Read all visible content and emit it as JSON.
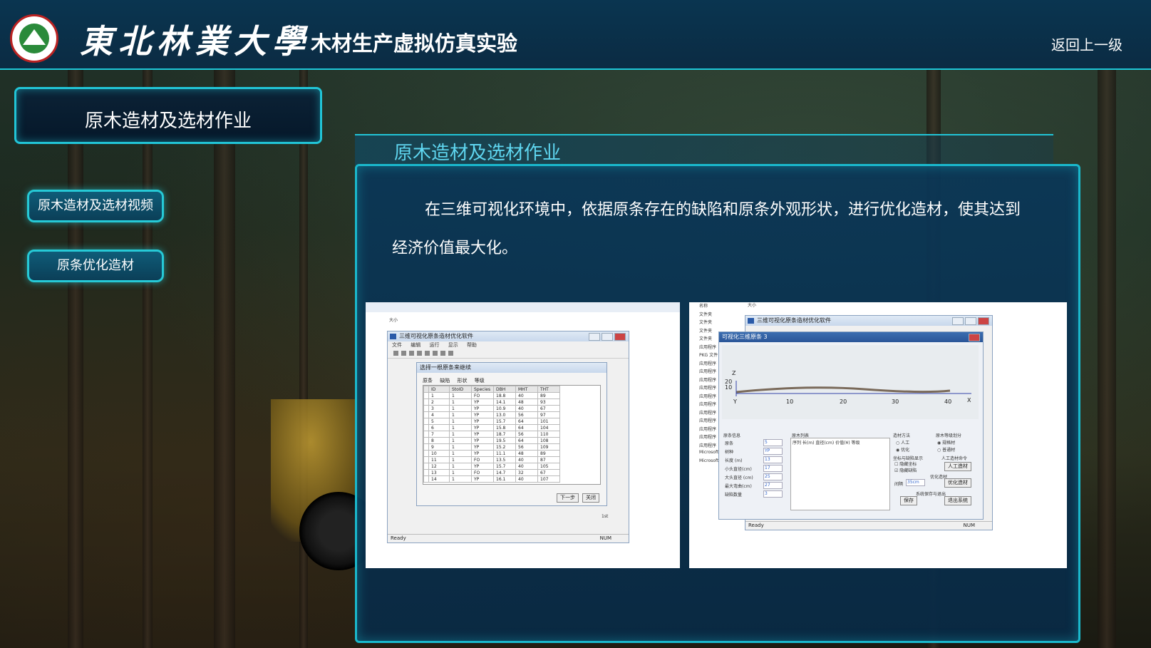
{
  "header": {
    "university": "東北林業大學",
    "app_title": "木材生产虚拟仿真实验",
    "back_label": "返回上一级"
  },
  "sidebar": {
    "title": "原木造材及选材作业",
    "items": [
      {
        "label": "原木造材及选材视频"
      },
      {
        "label": "原条优化造材"
      }
    ]
  },
  "main": {
    "heading": "原木造材及选材作业",
    "description": "在三维可视化环境中，依据原条存在的缺陷和原条外观形状，进行优化造材，使其达到经济价值最大化。"
  },
  "screenshot1": {
    "window_title": "三维可视化原条造材优化软件",
    "menu": [
      "文件",
      "编辑",
      "运行",
      "显示",
      "帮助"
    ],
    "dialog_title": "选择一根原条来继续",
    "tabs": [
      "原条",
      "缺陷",
      "形状",
      "等级"
    ],
    "columns": [
      "ID",
      "StoID",
      "Species",
      "DBH",
      "MHT",
      "THT"
    ],
    "rows": [
      [
        "1",
        "1",
        "FO",
        "18.8",
        "40",
        "89"
      ],
      [
        "2",
        "1",
        "YP",
        "14.1",
        "48",
        "93"
      ],
      [
        "3",
        "1",
        "YP",
        "10.9",
        "40",
        "67"
      ],
      [
        "4",
        "1",
        "YP",
        "13.0",
        "56",
        "97"
      ],
      [
        "5",
        "1",
        "YP",
        "15.7",
        "64",
        "101"
      ],
      [
        "6",
        "1",
        "YP",
        "15.8",
        "64",
        "104"
      ],
      [
        "7",
        "1",
        "YP",
        "18.7",
        "56",
        "110"
      ],
      [
        "8",
        "1",
        "YP",
        "19.5",
        "64",
        "108"
      ],
      [
        "9",
        "1",
        "YP",
        "15.2",
        "56",
        "109"
      ],
      [
        "10",
        "1",
        "YP",
        "11.1",
        "48",
        "89"
      ],
      [
        "11",
        "1",
        "FO",
        "13.5",
        "40",
        "87"
      ],
      [
        "12",
        "1",
        "YP",
        "15.7",
        "40",
        "105"
      ],
      [
        "13",
        "1",
        "FO",
        "14.7",
        "32",
        "67"
      ],
      [
        "14",
        "1",
        "YP",
        "16.1",
        "40",
        "107"
      ]
    ],
    "next_btn": "下一步",
    "close_btn": "关闭",
    "side_text": "1st",
    "status": "Ready",
    "num": "NUM",
    "explorer_label": "大小"
  },
  "screenshot2": {
    "window_title": "三维可视化原条造材优化软件",
    "sub_title": "可视化三维原条 3",
    "axis_labels": [
      "10",
      "20",
      "30",
      "40",
      "X",
      "Y",
      "Z",
      "20",
      "10"
    ],
    "info_group": "原条信息",
    "info_fields": [
      {
        "label": "原条",
        "value": "5"
      },
      {
        "label": "树种",
        "value": "YP"
      },
      {
        "label": "长度 (m)",
        "value": "13"
      },
      {
        "label": "小头直径(cm)",
        "value": "17"
      },
      {
        "label": "大头直径 (cm)",
        "value": "25"
      },
      {
        "label": "最大弯曲(cm)",
        "value": "27"
      },
      {
        "label": "缺陷数量",
        "value": "3"
      }
    ],
    "list_group": "原木列表",
    "list_columns": "序列  长(m)  直径(cm)  价值(¥)  等级",
    "method_group": "造材方法",
    "method_options": [
      "人工",
      "优化"
    ],
    "grade_group": "原木等级划分",
    "grade_options": [
      "规格材",
      "普通材"
    ],
    "display_group": "坐标与缺陷显示",
    "display_options": [
      "隐藏坐标",
      "隐藏缺陷"
    ],
    "manual_group": "人工造材命令",
    "manual_btn": "人工造材",
    "opt_group": "优化造材",
    "interval_label": "间隔",
    "interval_value": "35cm",
    "opt_btn": "优化造材",
    "save_group": "系统保存与退出",
    "save_btn": "保存",
    "exit_btn": "退出系统",
    "status": "Ready",
    "num": "NUM",
    "left_labels": [
      "名称",
      "文件夹",
      "文件夹",
      "文件夹",
      "文件夹",
      "应用程序",
      "PKG 文件",
      "应用程序",
      "应用程序",
      "应用程序",
      "应用程序",
      "应用程序",
      "应用程序",
      "应用程序",
      "应用程序",
      "应用程序",
      "应用程序",
      "应用程序",
      "Microsoft",
      "Microsoft"
    ],
    "top_label": "大小"
  },
  "colors": {
    "accent": "#21c4d6",
    "panel": "#0a3758",
    "heading": "#5fd6f0"
  }
}
